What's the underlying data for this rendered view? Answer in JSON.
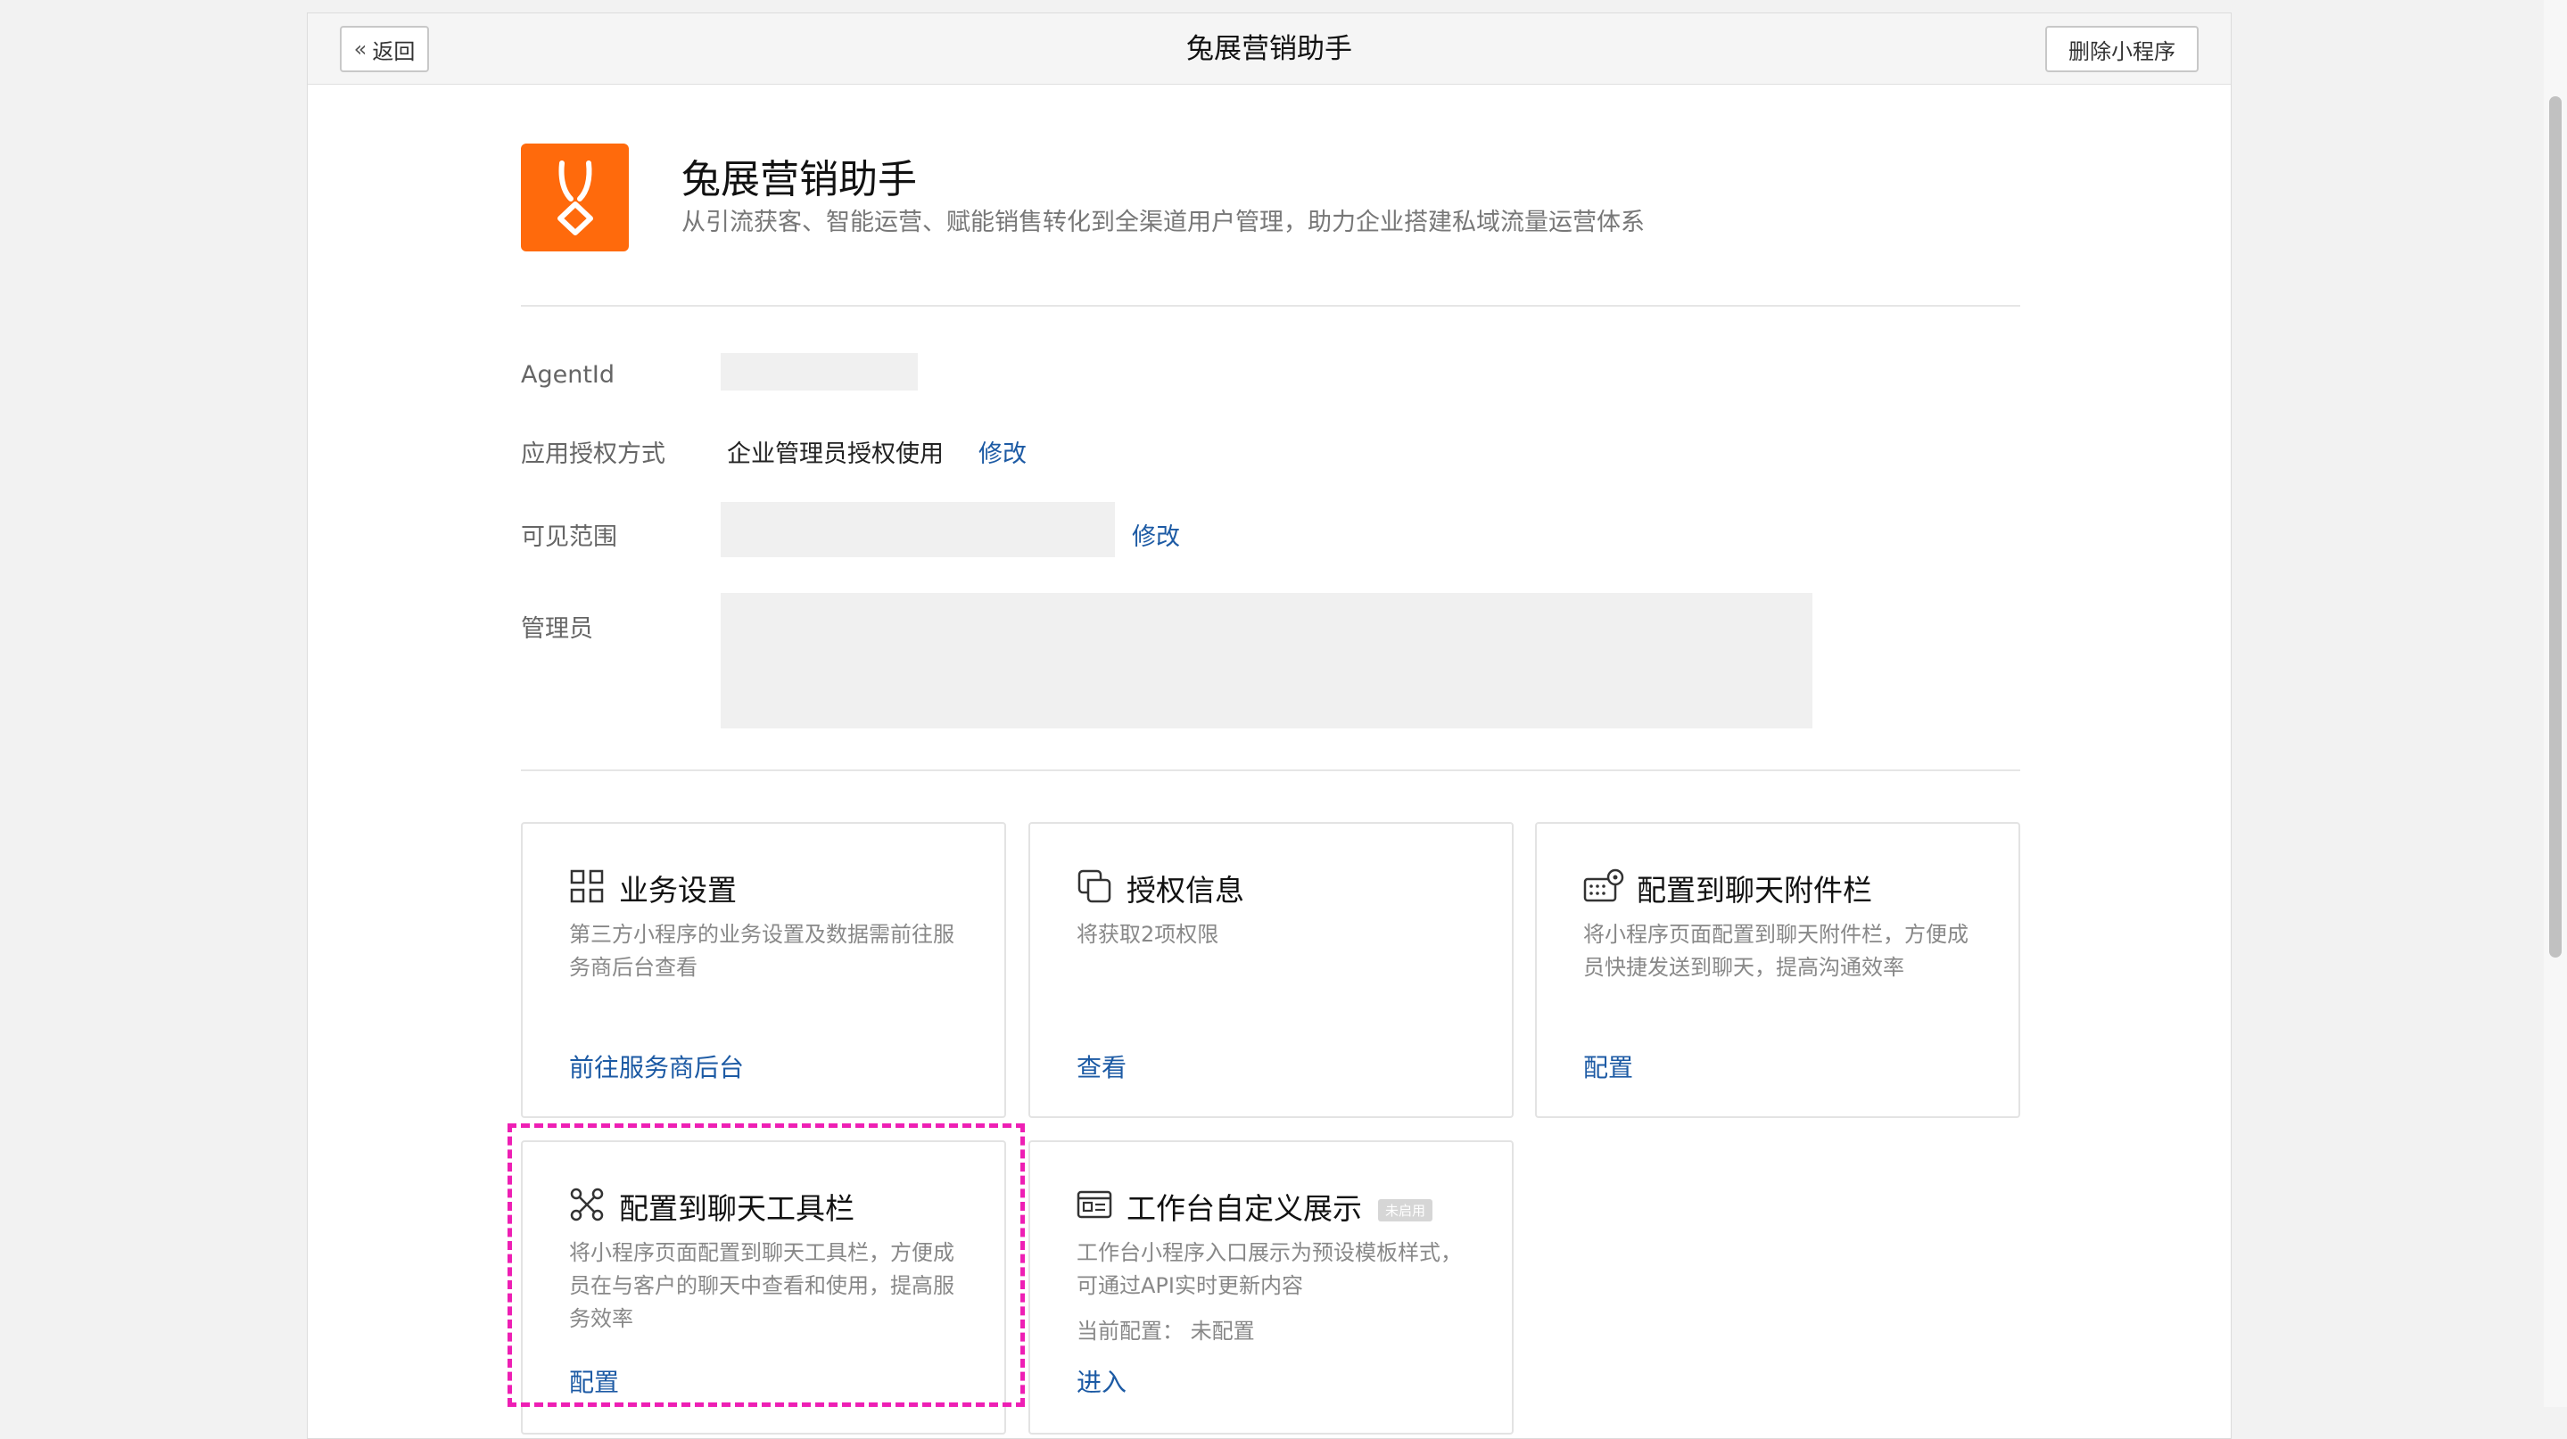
{
  "topbar": {
    "back_label": "返回",
    "title": "兔展营销助手",
    "delete_label": "删除小程序"
  },
  "app": {
    "name": "兔展营销助手",
    "description": "从引流获客、智能运营、赋能销售转化到全渠道用户管理，助力企业搭建私域流量运营体系",
    "logo_color": "#ff6a0c"
  },
  "fields": {
    "agentid_label": "AgentId",
    "auth_label": "应用授权方式",
    "auth_value": "企业管理员授权使用",
    "auth_edit": "修改",
    "visible_label": "可见范围",
    "visible_edit": "修改",
    "admin_label": "管理员"
  },
  "cards": {
    "business": {
      "title": "业务设置",
      "desc": "第三方小程序的业务设置及数据需前往服务商后台查看",
      "link": "前往服务商后台",
      "icon": "grid-icon"
    },
    "auth": {
      "title": "授权信息",
      "desc": "将获取2项权限",
      "link": "查看",
      "icon": "copy-icon"
    },
    "attach": {
      "title": "配置到聊天附件栏",
      "desc": "将小程序页面配置到聊天附件栏，方便成员快捷发送到聊天，提高沟通效率",
      "link": "配置",
      "icon": "keyboard-gear-icon"
    },
    "toolbar": {
      "title": "配置到聊天工具栏",
      "desc": "将小程序页面配置到聊天工具栏，方便成员在与客户的聊天中查看和使用，提高服务效率",
      "link": "配置",
      "icon": "tools-icon"
    },
    "workbench": {
      "title": "工作台自定义展示",
      "badge": "未启用",
      "desc": "工作台小程序入口展示为预设模板样式，可通过API实时更新内容",
      "status": "当前配置：  未配置",
      "link": "进入",
      "icon": "card-icon"
    }
  },
  "colors": {
    "link": "#1c5aa4",
    "highlight": "#ee1fb4"
  }
}
